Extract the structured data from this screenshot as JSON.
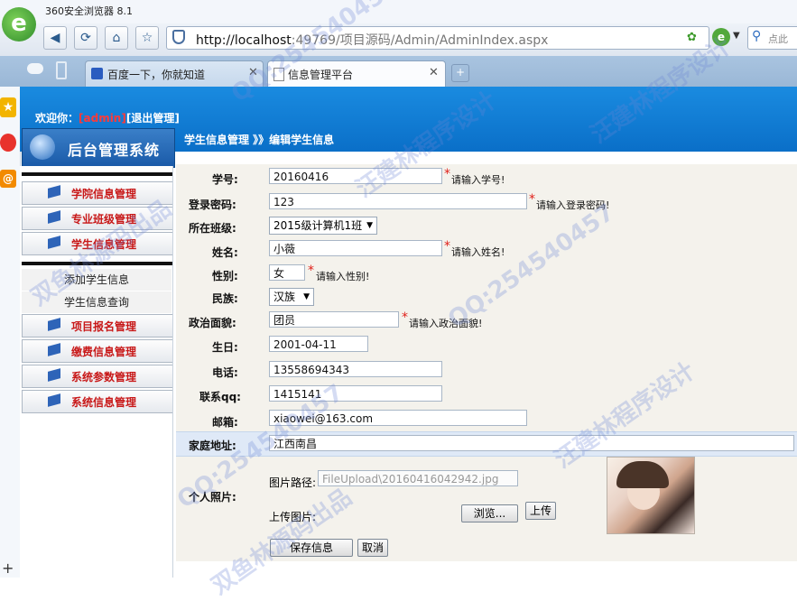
{
  "browser": {
    "app_title": "360安全浏览器 8.1",
    "url_host": "http://localhost",
    "url_rest": ":49769/项目源码/Admin/AdminIndex.aspx",
    "search_text": "点此",
    "tabs": [
      {
        "label": "百度一下，你就知道",
        "active": false
      },
      {
        "label": "信息管理平台",
        "active": true
      }
    ]
  },
  "header": {
    "welcome": "欢迎你：",
    "user": "[admin]",
    "logout": "[退出管理]",
    "logo_text": "后台管理系统",
    "breadcrumb": "学生信息管理 》》编辑学生信息"
  },
  "menu": {
    "group1": [
      "学院信息管理",
      "专业班级管理",
      "学生信息管理"
    ],
    "sub": [
      "添加学生信息",
      "学生信息查询"
    ],
    "group2": [
      "项目报名管理",
      "缴费信息管理",
      "系统参数管理",
      "系统信息管理"
    ]
  },
  "form": {
    "student_no": {
      "label": "学号:",
      "value": "20160416",
      "hint": "请输入学号!"
    },
    "password": {
      "label": "登录密码:",
      "value": "123",
      "hint": "请输入登录密码!"
    },
    "class": {
      "label": "所在班级:",
      "value": "2015级计算机1班"
    },
    "name": {
      "label": "姓名:",
      "value": "小薇",
      "hint": "请输入姓名!"
    },
    "gender": {
      "label": "性别:",
      "value": "女",
      "hint": "请输入性别!"
    },
    "ethnic": {
      "label": "民族:",
      "value": "汉族"
    },
    "political": {
      "label": "政治面貌:",
      "value": "团员",
      "hint": "请输入政治面貌!"
    },
    "birthday": {
      "label": "生日:",
      "value": "2001-04-11"
    },
    "phone": {
      "label": "电话:",
      "value": "13558694343"
    },
    "qq": {
      "label": "联系qq:",
      "value": "1415141"
    },
    "email": {
      "label": "邮箱:",
      "value": "xiaowei@163.com"
    },
    "address": {
      "label": "家庭地址:",
      "value": "江西南昌"
    },
    "photo": {
      "label": "个人照片:",
      "path_label": "图片路径:",
      "path_value": "FileUpload\\20160416042942.jpg",
      "upload_label": "上传图片:",
      "browse": "浏览...",
      "upload": "上传"
    },
    "save": "保存信息",
    "cancel": "取消"
  },
  "watermarks": [
    "QQ:254540457",
    "汪建林程序设计",
    "双鱼林源码出品",
    "QQ:254540457",
    "汪建林程序设计",
    "QQ:254540457",
    "双鱼林源码出品",
    "汪建林程序设计"
  ],
  "colors": {
    "header_blue": "#0a6fc8",
    "menu_red": "#c81818",
    "required": "#e0201a"
  }
}
